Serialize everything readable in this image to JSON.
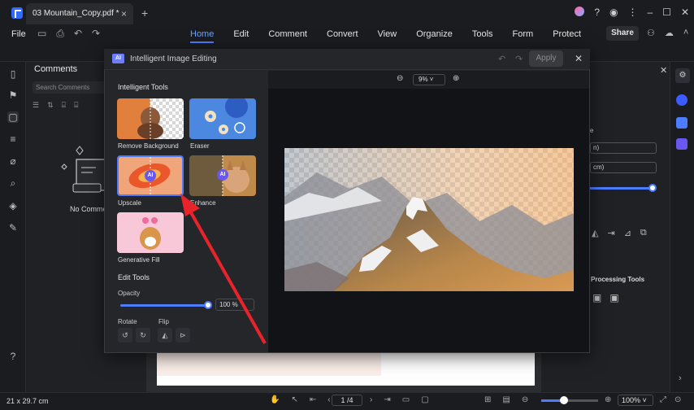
{
  "window": {
    "tab_title": "03 Mountain_Copy.pdf *"
  },
  "menubar": {
    "file": "File",
    "tabs": [
      "Home",
      "Edit",
      "Comment",
      "Convert",
      "View",
      "Organize",
      "Tools",
      "Form",
      "Protect"
    ],
    "active_tab": "Home",
    "share": "Share"
  },
  "comments_panel": {
    "title": "Comments",
    "search_placeholder": "Search Comments",
    "empty_text": "No Comment"
  },
  "right_panel": {
    "field1": "n)",
    "field2": "cm)",
    "section_label": "Processing Tools"
  },
  "dialog": {
    "badge": "AI",
    "title": "Intelligent Image Editing",
    "apply": "Apply",
    "intelligent_tools_heading": "Intelligent Tools",
    "tools": [
      {
        "label": "Remove Background"
      },
      {
        "label": "Eraser"
      },
      {
        "label": "Upscale"
      },
      {
        "label": "Enhance"
      },
      {
        "label": "Generative Fill"
      }
    ],
    "ai_chip": "AI",
    "edit_tools_heading": "Edit Tools",
    "opacity_label": "Opacity",
    "opacity_value": "100 %",
    "opacity_fraction": 1.0,
    "rotate_label": "Rotate",
    "flip_label": "Flip",
    "preview_zoom": "9%"
  },
  "statusbar": {
    "page_size": "21 x 29.7 cm",
    "page_indicator": "1 /4",
    "zoom": "100%"
  },
  "colors": {
    "accent": "#4d7cff",
    "arrow": "#e8242a"
  }
}
